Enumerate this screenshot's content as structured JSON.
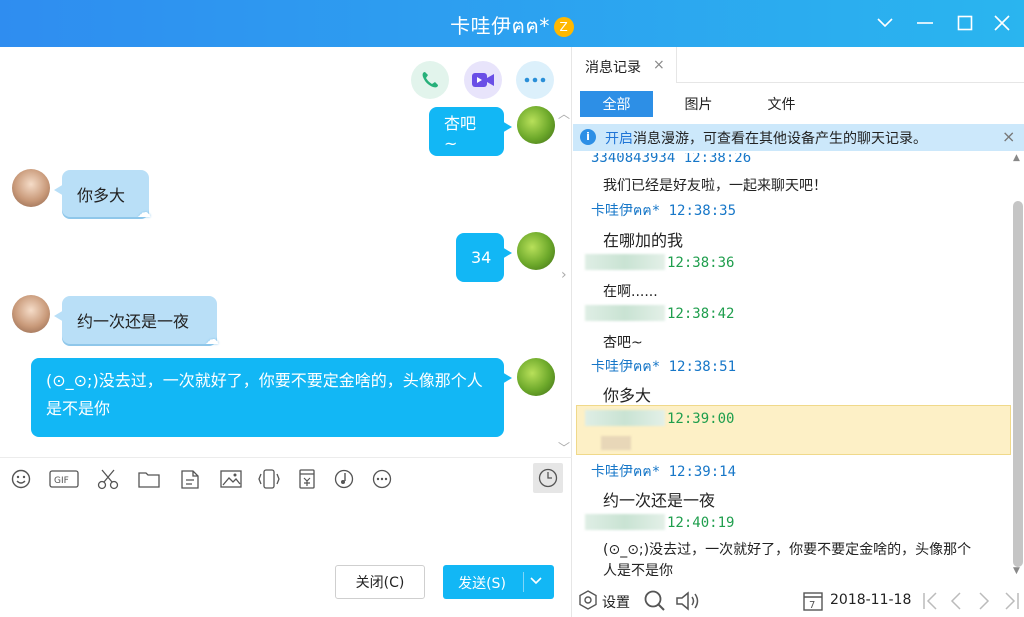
{
  "window": {
    "title": "卡哇伊ฅฅ*",
    "star": "Z"
  },
  "chat": {
    "messages": [
      {
        "dir": "out",
        "text": "杏吧~"
      },
      {
        "dir": "in",
        "text": "你多大"
      },
      {
        "dir": "out",
        "text": "34"
      },
      {
        "dir": "in",
        "text": "约一次还是一夜"
      },
      {
        "dir": "out",
        "text": "(⊙_⊙;)没去过，一次就好了，你要不要定金啥的，头像那个人是不是你"
      }
    ],
    "close_label": "关闭(C)",
    "send_label": "发送(S)"
  },
  "history": {
    "tab_label": "消息记录",
    "filters": [
      "全部",
      "图片",
      "文件"
    ],
    "notice": {
      "link": "开启",
      "text": "消息漫游，可查看在其他设备产生的聊天记录。"
    },
    "items": [
      {
        "meta": "3340843934 12:38:26",
        "sender": "her",
        "text": "我们已经是好友啦，一起来聊天吧！"
      },
      {
        "meta": "卡哇伊ฅฅ* 12:38:35",
        "sender": "her",
        "text": "在哪加的我"
      },
      {
        "meta": "12:38:36",
        "sender": "me",
        "text": "在啊......"
      },
      {
        "meta": "12:38:42",
        "sender": "me",
        "text": "杏吧~"
      },
      {
        "meta": "卡哇伊ฅฅ* 12:38:51",
        "sender": "her",
        "text": "你多大"
      },
      {
        "meta": "12:39:00",
        "sender": "me",
        "text": ""
      },
      {
        "meta": "卡哇伊ฅฅ* 12:39:14",
        "sender": "her",
        "text": "约一次还是一夜"
      },
      {
        "meta": "12:40:19",
        "sender": "me",
        "text": "(⊙_⊙;)没去过，一次就好了，你要不要定金啥的，头像那个人是不是你"
      }
    ],
    "settings_label": "设置",
    "date": "2018-11-18"
  },
  "colors": {
    "accent": "#12b7f5",
    "title_start": "#2f8df0",
    "highlight": "#fdf0c6"
  }
}
